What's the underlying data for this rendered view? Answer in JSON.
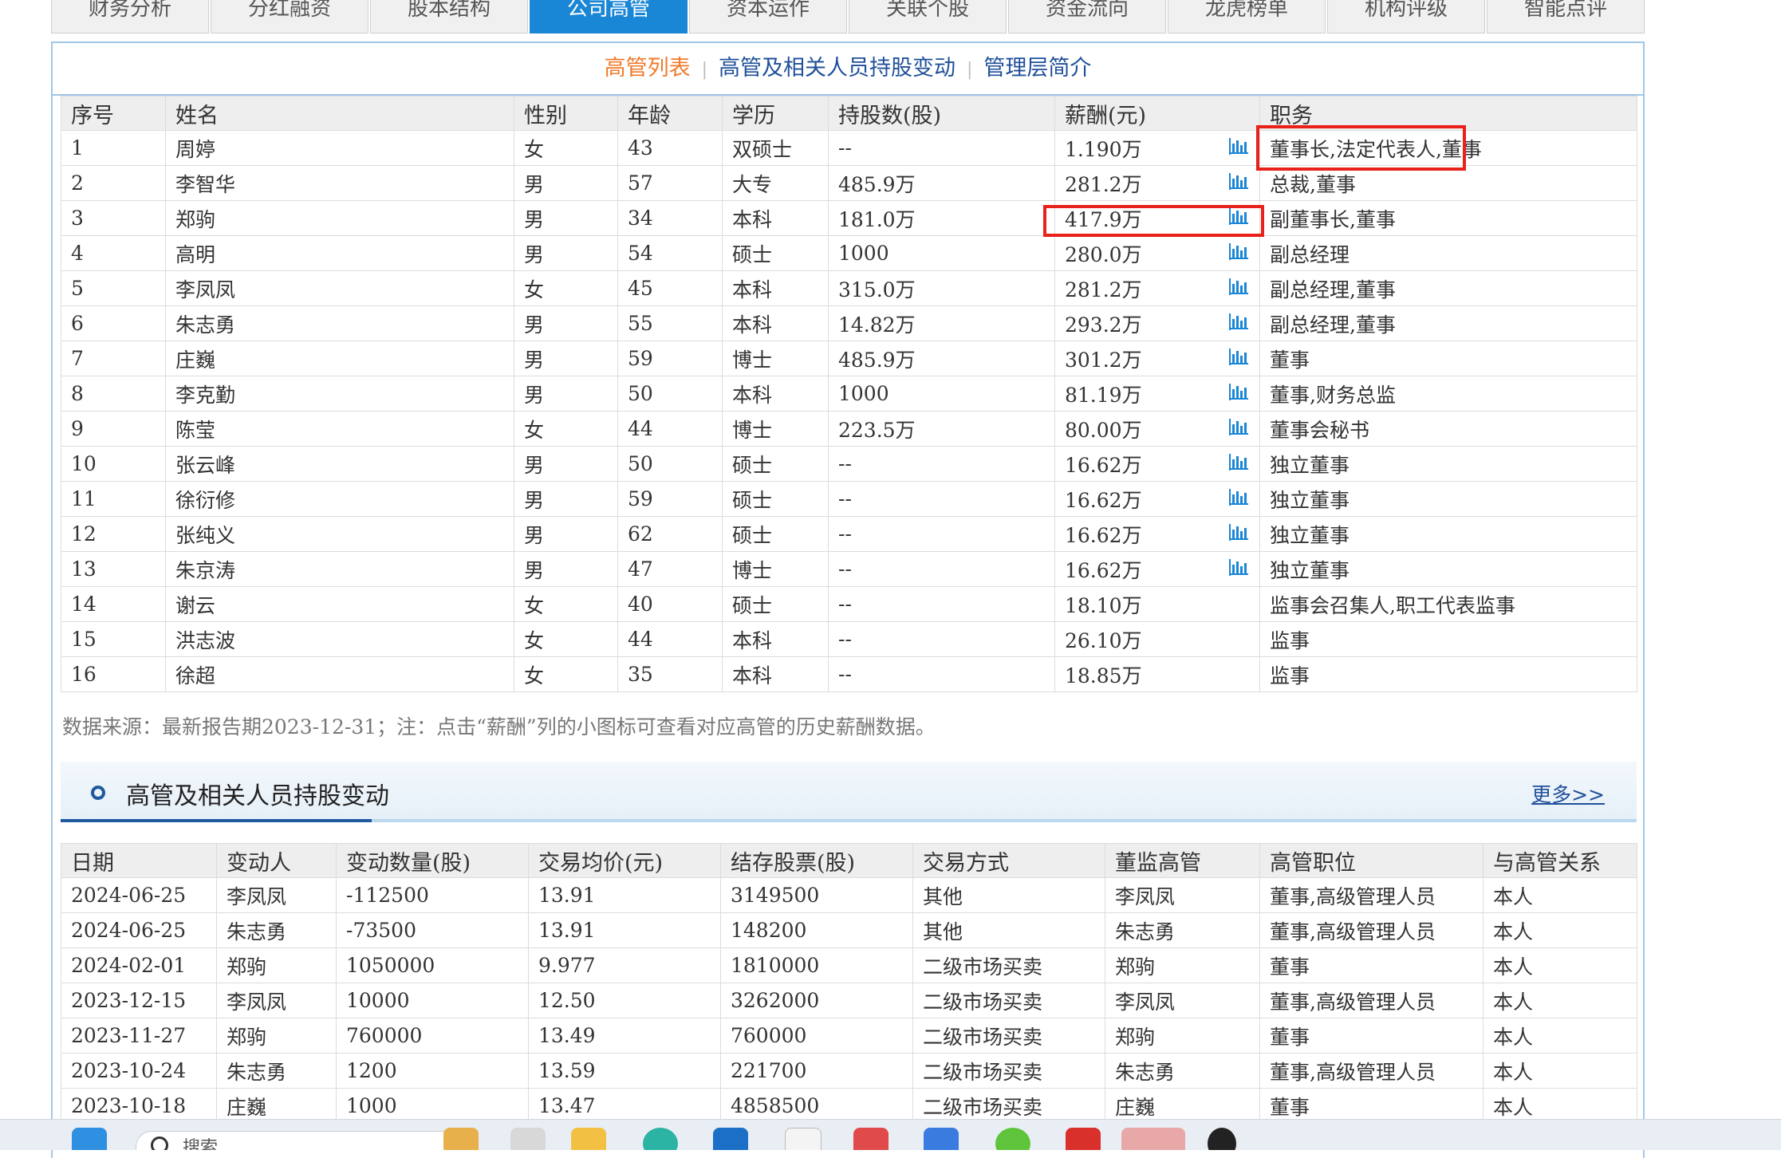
{
  "tabs": [
    {
      "label": "财务分析",
      "active": false
    },
    {
      "label": "分红融资",
      "active": false
    },
    {
      "label": "股本结构",
      "active": false
    },
    {
      "label": "公司高管",
      "active": true
    },
    {
      "label": "资本运作",
      "active": false
    },
    {
      "label": "关联个股",
      "active": false
    },
    {
      "label": "资金流向",
      "active": false
    },
    {
      "label": "龙虎榜单",
      "active": false
    },
    {
      "label": "机构评级",
      "active": false
    },
    {
      "label": "智能点评",
      "active": false
    }
  ],
  "subnav": {
    "items": [
      "高管列表",
      "高管及相关人员持股变动",
      "管理层简介"
    ],
    "active": "高管列表",
    "separator": "|"
  },
  "exec_table": {
    "headers": [
      "序号",
      "姓名",
      "性别",
      "年龄",
      "学历",
      "持股数(股)",
      "薪酬(元)",
      "职务"
    ],
    "rows": [
      {
        "no": "1",
        "name": "周婷",
        "gender": "女",
        "age": "43",
        "edu": "双硕士",
        "shares": "--",
        "salary": "1.190万",
        "chart": true,
        "title": "董事长,法定代表人,董事"
      },
      {
        "no": "2",
        "name": "李智华",
        "gender": "男",
        "age": "57",
        "edu": "大专",
        "shares": "485.9万",
        "salary": "281.2万",
        "chart": true,
        "title": "总裁,董事"
      },
      {
        "no": "3",
        "name": "郑驹",
        "gender": "男",
        "age": "34",
        "edu": "本科",
        "shares": "181.0万",
        "salary": "417.9万",
        "chart": true,
        "title": "副董事长,董事"
      },
      {
        "no": "4",
        "name": "高明",
        "gender": "男",
        "age": "54",
        "edu": "硕士",
        "shares": "1000",
        "salary": "280.0万",
        "chart": true,
        "title": "副总经理"
      },
      {
        "no": "5",
        "name": "李凤凤",
        "gender": "女",
        "age": "45",
        "edu": "本科",
        "shares": "315.0万",
        "salary": "281.2万",
        "chart": true,
        "title": "副总经理,董事"
      },
      {
        "no": "6",
        "name": "朱志勇",
        "gender": "男",
        "age": "55",
        "edu": "本科",
        "shares": "14.82万",
        "salary": "293.2万",
        "chart": true,
        "title": "副总经理,董事"
      },
      {
        "no": "7",
        "name": "庄巍",
        "gender": "男",
        "age": "59",
        "edu": "博士",
        "shares": "485.9万",
        "salary": "301.2万",
        "chart": true,
        "title": "董事"
      },
      {
        "no": "8",
        "name": "李克勤",
        "gender": "男",
        "age": "50",
        "edu": "本科",
        "shares": "1000",
        "salary": "81.19万",
        "chart": true,
        "title": "董事,财务总监"
      },
      {
        "no": "9",
        "name": "陈莹",
        "gender": "女",
        "age": "44",
        "edu": "博士",
        "shares": "223.5万",
        "salary": "80.00万",
        "chart": true,
        "title": "董事会秘书"
      },
      {
        "no": "10",
        "name": "张云峰",
        "gender": "男",
        "age": "50",
        "edu": "硕士",
        "shares": "--",
        "salary": "16.62万",
        "chart": true,
        "title": "独立董事"
      },
      {
        "no": "11",
        "name": "徐衍修",
        "gender": "男",
        "age": "59",
        "edu": "硕士",
        "shares": "--",
        "salary": "16.62万",
        "chart": true,
        "title": "独立董事"
      },
      {
        "no": "12",
        "name": "张纯义",
        "gender": "男",
        "age": "62",
        "edu": "硕士",
        "shares": "--",
        "salary": "16.62万",
        "chart": true,
        "title": "独立董事"
      },
      {
        "no": "13",
        "name": "朱京涛",
        "gender": "男",
        "age": "47",
        "edu": "博士",
        "shares": "--",
        "salary": "16.62万",
        "chart": true,
        "title": "独立董事"
      },
      {
        "no": "14",
        "name": "谢云",
        "gender": "女",
        "age": "40",
        "edu": "硕士",
        "shares": "--",
        "salary": "18.10万",
        "chart": false,
        "title": "监事会召集人,职工代表监事"
      },
      {
        "no": "15",
        "name": "洪志波",
        "gender": "女",
        "age": "44",
        "edu": "本科",
        "shares": "--",
        "salary": "26.10万",
        "chart": false,
        "title": "监事"
      },
      {
        "no": "16",
        "name": "徐超",
        "gender": "女",
        "age": "35",
        "edu": "本科",
        "shares": "--",
        "salary": "18.85万",
        "chart": false,
        "title": "监事"
      }
    ]
  },
  "source_note": "数据来源：最新报告期2023-12-31；注：点击“薪酬”列的小图标可查看对应高管的历史薪酬数据。",
  "change_section": {
    "title": "高管及相关人员持股变动",
    "more_label": "更多>>"
  },
  "change_table": {
    "headers": [
      "日期",
      "变动人",
      "变动数量(股)",
      "交易均价(元)",
      "结存股票(股)",
      "交易方式",
      "董监高管",
      "高管职位",
      "与高管关系"
    ],
    "rows": [
      [
        "2024-06-25",
        "李凤凤",
        "-112500",
        "13.91",
        "3149500",
        "其他",
        "李凤凤",
        "董事,高级管理人员",
        "本人"
      ],
      [
        "2024-06-25",
        "朱志勇",
        "-73500",
        "13.91",
        "148200",
        "其他",
        "朱志勇",
        "董事,高级管理人员",
        "本人"
      ],
      [
        "2024-02-01",
        "郑驹",
        "1050000",
        "9.977",
        "1810000",
        "二级市场买卖",
        "郑驹",
        "董事",
        "本人"
      ],
      [
        "2023-12-15",
        "李凤凤",
        "10000",
        "12.50",
        "3262000",
        "二级市场买卖",
        "李凤凤",
        "董事,高级管理人员",
        "本人"
      ],
      [
        "2023-11-27",
        "郑驹",
        "760000",
        "13.49",
        "760000",
        "二级市场买卖",
        "郑驹",
        "董事",
        "本人"
      ],
      [
        "2023-10-24",
        "朱志勇",
        "1200",
        "13.59",
        "221700",
        "二级市场买卖",
        "朱志勇",
        "董事,高级管理人员",
        "本人"
      ],
      [
        "2023-10-18",
        "庄巍",
        "1000",
        "13.47",
        "4858500",
        "二级市场买卖",
        "庄巍",
        "董事",
        "本人"
      ]
    ]
  },
  "taskbar": {
    "search_placeholder": "搜索"
  },
  "colors": {
    "active_tab": "#1a86d6",
    "subnav_active": "#f07a2a",
    "link": "#1f4f9a",
    "highlight_box": "#e8221b",
    "chart_icon": "#1a86d6"
  }
}
